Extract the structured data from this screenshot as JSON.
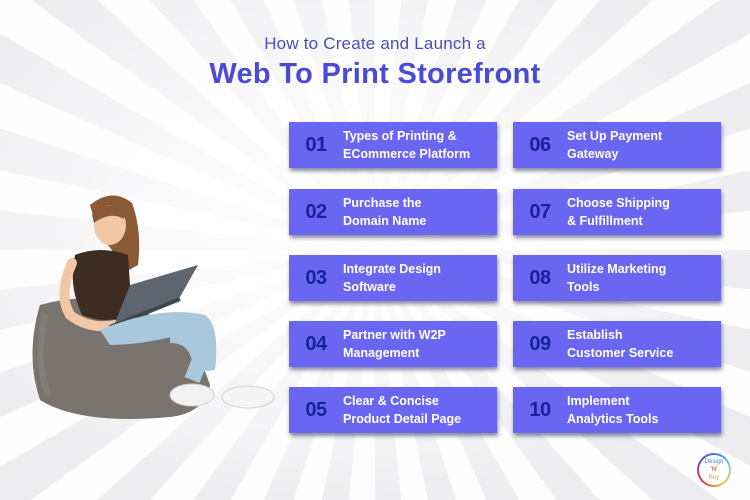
{
  "header": {
    "subtitle": "How to Create and Launch a",
    "title": "Web To Print Storefront"
  },
  "steps": [
    {
      "number": "01",
      "label": "Types of Printing &\nECommerce Platform"
    },
    {
      "number": "02",
      "label": "Purchase the\nDomain Name"
    },
    {
      "number": "03",
      "label": "Integrate Design\nSoftware"
    },
    {
      "number": "04",
      "label": "Partner with W2P\nManagement"
    },
    {
      "number": "05",
      "label": "Clear & Concise\nProduct Detail Page"
    },
    {
      "number": "06",
      "label": "Set Up Payment\nGateway"
    },
    {
      "number": "07",
      "label": "Choose Shipping\n& Fulfillment"
    },
    {
      "number": "08",
      "label": "Utilize Marketing\nTools"
    },
    {
      "number": "09",
      "label": "Establish\nCustomer Service"
    },
    {
      "number": "10",
      "label": "Implement\nAnalytics Tools"
    }
  ],
  "illustration": {
    "description": "woman-on-beanbag-with-laptop"
  },
  "logo": {
    "line1": "Design",
    "line2": "'N'",
    "line3": "Buy"
  },
  "colors": {
    "card": "#6b66f2",
    "number": "#16239b",
    "title": "#4a4ad6"
  }
}
